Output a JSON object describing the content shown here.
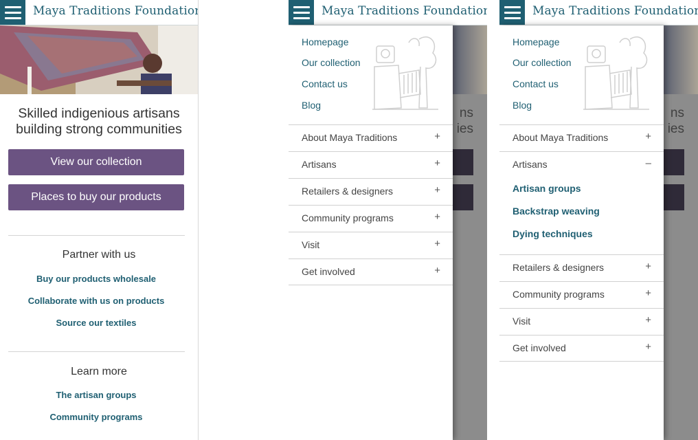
{
  "brand": "Maya Traditions Foundation",
  "home": {
    "tagline_line1": "Skilled indigenious artisans",
    "tagline_line2": "building strong communities",
    "btn_collection": "View our collection",
    "btn_places": "Places to buy our products",
    "partner_heading": "Partner with us",
    "partner_links": [
      "Buy our products wholesale",
      "Collaborate with us on products",
      "Source our textiles"
    ],
    "learn_heading": "Learn more",
    "learn_links": [
      "The artisan groups",
      "Community programs"
    ]
  },
  "menu": {
    "top_links": [
      "Homepage",
      "Our collection",
      "Contact us",
      "Blog"
    ],
    "sections": [
      "About Maya Traditions",
      "Artisans",
      "Retailers & designers",
      "Community programs",
      "Visit",
      "Get involved"
    ],
    "plus": "+",
    "minus": "–",
    "artisans_sublinks": [
      "Artisan groups",
      "Backstrap weaving",
      "Dying techniques"
    ],
    "bg_text_1": "ns",
    "bg_text_2": "ies"
  },
  "colors": {
    "brand_teal": "#1f5f72",
    "button_purple": "#6b5382"
  },
  "icons": [
    "hamburger-menu-icon",
    "plus-icon",
    "minus-icon",
    "maya-glyph-illustration"
  ]
}
